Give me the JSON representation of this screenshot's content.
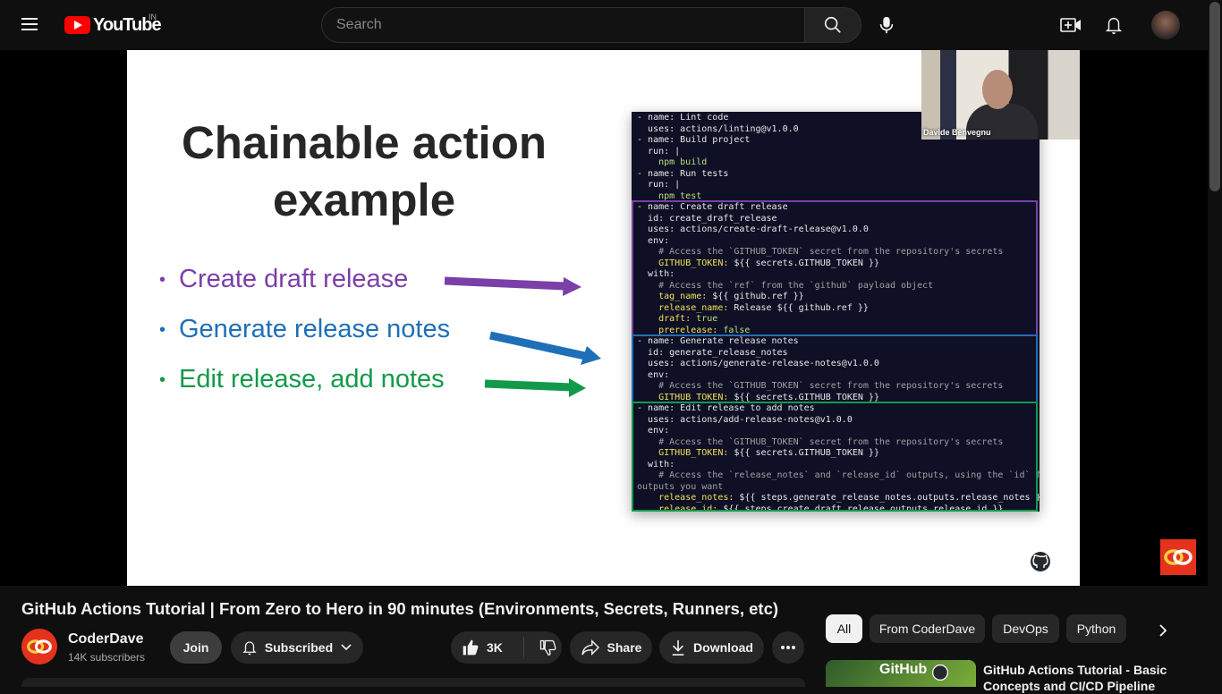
{
  "header": {
    "logo_text": "YouTube",
    "country_code": "IN",
    "search_placeholder": "Search"
  },
  "slide": {
    "title_line1": "Chainable action",
    "title_line2": "example",
    "bullets": [
      {
        "text": "Create draft release",
        "color": "#7b3fa8"
      },
      {
        "text": "Generate release notes",
        "color": "#1f6fb8"
      },
      {
        "text": "Edit release, add notes",
        "color": "#129a4a"
      }
    ],
    "presenter_name": "Davide Benvegnu",
    "box_colors": {
      "purple": "#7b3fa8",
      "blue": "#1f6fb8",
      "green": "#129a4a"
    }
  },
  "code_lines": [
    "- name: Lint code",
    "  uses: actions/linting@v1.0.0",
    "- name: Build project",
    "  run: |",
    "    npm build",
    "- name: Run tests",
    "  run: |",
    "    npm test",
    "- name: Create draft release",
    "  id: create_draft_release",
    "  uses: actions/create-draft-release@v1.0.0",
    "  env:",
    "    # Access the `GITHUB_TOKEN` secret from the repository's secrets",
    "    GITHUB_TOKEN: ${{ secrets.GITHUB_TOKEN }}",
    "  with:",
    "    # Access the `ref` from the `github` payload object",
    "    tag_name: ${{ github.ref }}",
    "    release_name: Release ${{ github.ref }}",
    "    draft: true",
    "    prerelease: false",
    "- name: Generate release notes",
    "  id: generate_release_notes",
    "  uses: actions/generate-release-notes@v1.0.0",
    "  env:",
    "    # Access the `GITHUB_TOKEN` secret from the repository's secrets",
    "    GITHUB_TOKEN: ${{ secrets.GITHUB_TOKEN }}",
    "- name: Edit release to add notes",
    "  uses: actions/add-release-notes@v1.0.0",
    "  env:",
    "    # Access the `GITHUB_TOKEN` secret from the repository's secrets",
    "    GITHUB_TOKEN: ${{ secrets.GITHUB_TOKEN }}",
    "  with:",
    "    # Access the `release_notes` and `release_id` outputs, using the `id` fro",
    "outputs you want",
    "    release_notes: ${{ steps.generate_release_notes.outputs.release_notes }}",
    "    release_id: ${{ steps.create_draft_release.outputs.release_id }}"
  ],
  "video": {
    "title": "GitHub Actions Tutorial | From Zero to Hero in 90 minutes (Environments, Secrets, Runners, etc)",
    "channel_name": "CoderDave",
    "subscribers": "14K subscribers",
    "join_label": "Join",
    "subscribed_label": "Subscribed",
    "likes": "3K",
    "share_label": "Share",
    "download_label": "Download"
  },
  "chips": [
    "All",
    "From CoderDave",
    "DevOps",
    "Python"
  ],
  "recommendation": {
    "thumb_text": "GitHub",
    "title": "GitHub Actions Tutorial - Basic Concepts and CI/CD Pipeline"
  }
}
